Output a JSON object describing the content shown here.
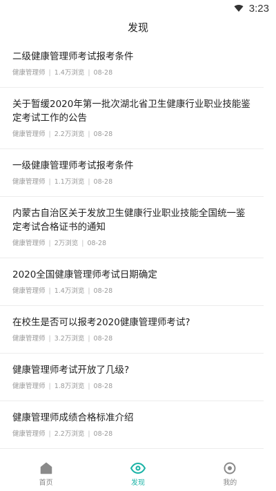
{
  "status": {
    "time": "3:23",
    "wifi_icon": "wifi-icon"
  },
  "header": {
    "title": "发现"
  },
  "articles": [
    {
      "title": "二级健康管理师考试报考条件",
      "source": "健康管理师",
      "views": "1.4万浏览",
      "date": "08-28"
    },
    {
      "title": "关于暂缓2020年第一批次湖北省卫生健康行业职业技能鉴定考试工作的公告",
      "source": "健康管理师",
      "views": "2.2万浏览",
      "date": "08-28"
    },
    {
      "title": "一级健康管理师考试报考条件",
      "source": "健康管理师",
      "views": "1.1万浏览",
      "date": "08-28"
    },
    {
      "title": "内蒙古自治区关于发放卫生健康行业职业技能全国统一鉴定考试合格证书的通知",
      "source": "健康管理师",
      "views": "2万浏览",
      "date": "08-28"
    },
    {
      "title": "2020全国健康管理师考试日期确定",
      "source": "健康管理师",
      "views": "1.4万浏览",
      "date": "08-28"
    },
    {
      "title": "在校生是否可以报考2020健康管理师考试?",
      "source": "健康管理师",
      "views": "3.2万浏览",
      "date": "08-28"
    },
    {
      "title": "健康管理师考试开放了几级?",
      "source": "健康管理师",
      "views": "1.8万浏览",
      "date": "08-28"
    },
    {
      "title": "健康管理师成绩合格标准介绍",
      "source": "健康管理师",
      "views": "2.2万浏览",
      "date": "08-28"
    }
  ],
  "nav": {
    "home": {
      "label": "首页",
      "icon": "home-icon"
    },
    "discover": {
      "label": "发现",
      "icon": "eye-icon"
    },
    "mine": {
      "label": "我的",
      "icon": "profile-icon"
    }
  },
  "colors": {
    "accent": "#1bb3a6",
    "inactive": "#888888"
  }
}
